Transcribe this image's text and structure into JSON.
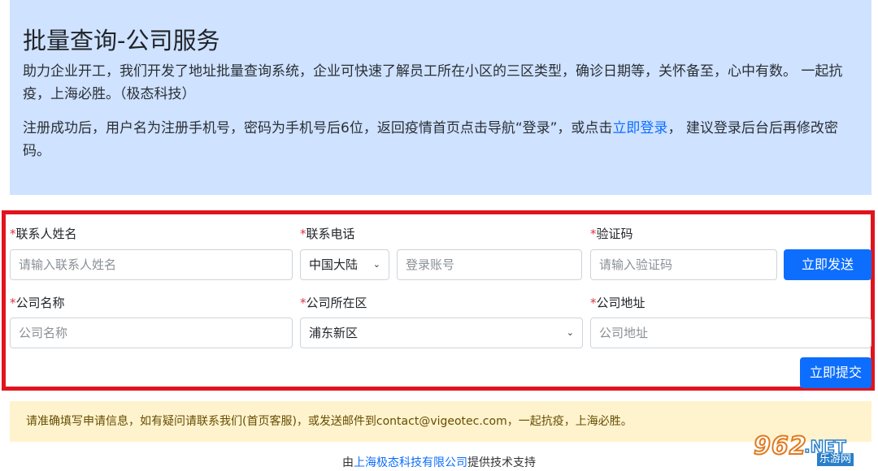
{
  "hero": {
    "title": "批量查询-公司服务",
    "description": "助力企业开工，我们开发了地址批量查询系统，企业可快速了解员工所在小区的三区类型，确诊日期等，关怀备至，心中有数。 一起抗疫，上海必胜。（极态科技）",
    "note_prefix": "注册成功后，用户名为注册手机号，密码为手机号后6位，返回疫情首页点击导航“登录”，或点击",
    "note_link": "立即登录",
    "note_suffix": "， 建议登录后台后再修改密码。"
  },
  "form": {
    "required_mark": "*",
    "contact_name": {
      "label": "联系人姓名",
      "placeholder": "请输入联系人姓名"
    },
    "phone": {
      "label": "联系电话",
      "region": "中国大陆",
      "placeholder": "登录账号"
    },
    "code": {
      "label": "验证码",
      "placeholder": "请输入验证码",
      "send_button": "立即发送"
    },
    "company_name": {
      "label": "公司名称",
      "placeholder": "公司名称"
    },
    "district": {
      "label": "公司所在区",
      "selected": "浦东新区"
    },
    "address": {
      "label": "公司地址",
      "placeholder": "公司地址"
    },
    "submit_button": "立即提交"
  },
  "alert": {
    "text": "请准确填写申请信息，如有疑问请联系我们(首页客服)，或发送邮件到contact@vigeotec.com，一起抗疫，上海必胜。"
  },
  "footer": {
    "prefix": "由",
    "link": "上海极态科技有限公司",
    "suffix": "提供技术支持"
  },
  "watermark": {
    "number": "962",
    "net": ".NET",
    "site": "乐游网"
  },
  "colors": {
    "hero_bg": "#cfe2ff",
    "frame_border": "#e1141e",
    "primary": "#0d6efd",
    "alert_bg": "#fff3cd",
    "required": "#dc3545"
  }
}
